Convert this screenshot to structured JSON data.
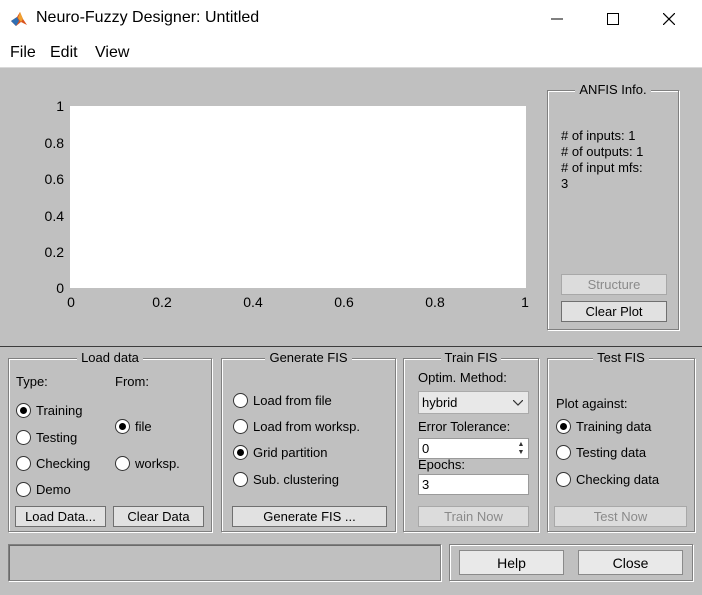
{
  "window": {
    "title": "Neuro-Fuzzy Designer: Untitled",
    "controls": {
      "minimize": "—",
      "maximize": "☐",
      "close": "✕"
    }
  },
  "menu": [
    "File",
    "Edit",
    "View"
  ],
  "plot": {
    "yticks": [
      "1",
      "0.8",
      "0.6",
      "0.4",
      "0.2",
      "0"
    ],
    "xticks": [
      "0",
      "0.2",
      "0.4",
      "0.6",
      "0.8",
      "1"
    ]
  },
  "anfis_info": {
    "title": "ANFIS Info.",
    "inputs": "# of inputs: 1",
    "outputs": "# of outputs: 1",
    "input_mfs_label": "# of input mfs:",
    "input_mfs_value": "3",
    "structure_button": "Structure",
    "clear_plot_button": "Clear Plot"
  },
  "load_data": {
    "title": "Load data",
    "type_label": "Type:",
    "from_label": "From:",
    "types": [
      "Training",
      "Testing",
      "Checking",
      "Demo"
    ],
    "selected_type": "Training",
    "sources": [
      "file",
      "worksp."
    ],
    "selected_source": "file",
    "load_button": "Load Data...",
    "clear_button": "Clear Data"
  },
  "generate_fis": {
    "title": "Generate FIS",
    "options": [
      "Load from file",
      "Load from worksp.",
      "Grid partition",
      "Sub. clustering"
    ],
    "selected": "Grid partition",
    "button": "Generate FIS ..."
  },
  "train_fis": {
    "title": "Train FIS",
    "method_label": "Optim. Method:",
    "method_value": "hybrid",
    "tolerance_label": "Error Tolerance:",
    "tolerance_value": "0",
    "epochs_label": "Epochs:",
    "epochs_value": "3",
    "button": "Train Now"
  },
  "test_fis": {
    "title": "Test FIS",
    "plot_against_label": "Plot against:",
    "options": [
      "Training data",
      "Testing data",
      "Checking data"
    ],
    "selected": "Training data",
    "button": "Test Now"
  },
  "footer": {
    "status_text": "",
    "help_button": "Help",
    "close_button": "Close"
  }
}
